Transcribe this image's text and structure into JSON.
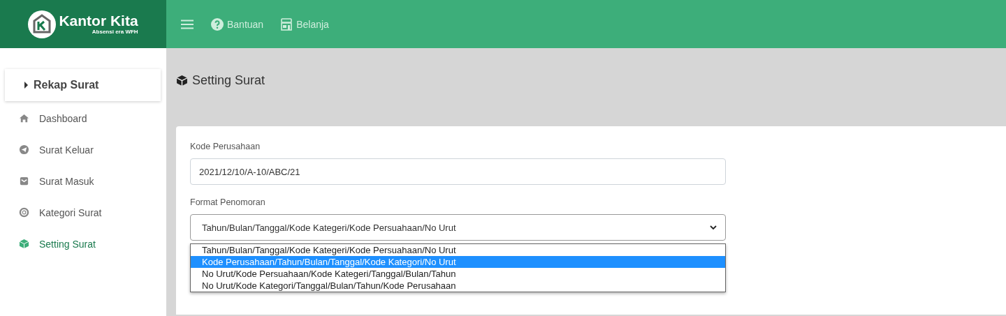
{
  "brand": {
    "name": "Kantor Kita",
    "tagline": "Absensi era WFH"
  },
  "topnav": [
    {
      "kind": "help",
      "label": "Bantuan"
    },
    {
      "kind": "shop",
      "label": "Belanja"
    }
  ],
  "sidebar": {
    "header": "Rekap Surat",
    "items": [
      {
        "kind": "home",
        "label": "Dashboard",
        "selected": false
      },
      {
        "kind": "send",
        "label": "Surat Keluar",
        "selected": false
      },
      {
        "kind": "mail",
        "label": "Surat Masuk",
        "selected": false
      },
      {
        "kind": "ring",
        "label": "Kategori Surat",
        "selected": false
      },
      {
        "kind": "box",
        "label": "Setting Surat",
        "selected": true
      }
    ]
  },
  "page_title": "Setting Surat",
  "form": {
    "company_label": "Kode Perusahaan",
    "company_value": "2021/12/10/A-10/ABC/21",
    "format_label": "Format Penomoran",
    "format_value": "Tahun/Bulan/Tanggal/Kode Kategeri/Kode Persuahaan/No Urut",
    "options": [
      {
        "label": "Tahun/Bulan/Tanggal/Kode Kategeri/Kode Persuahaan/No Urut",
        "selected": false
      },
      {
        "label": "Kode Perusahaan/Tahun/Bulan/Tanggal/Kode Kategori/No Urut",
        "selected": true
      },
      {
        "label": "No Urut/Kode Persuahaan/Kode Kategeri/Tanggal/Bulan/Tahun",
        "selected": false
      },
      {
        "label": "No Urut/Kode Kategori/Tanggal/Bulan/Tahun/Kode Perusahaan",
        "selected": false
      }
    ]
  }
}
